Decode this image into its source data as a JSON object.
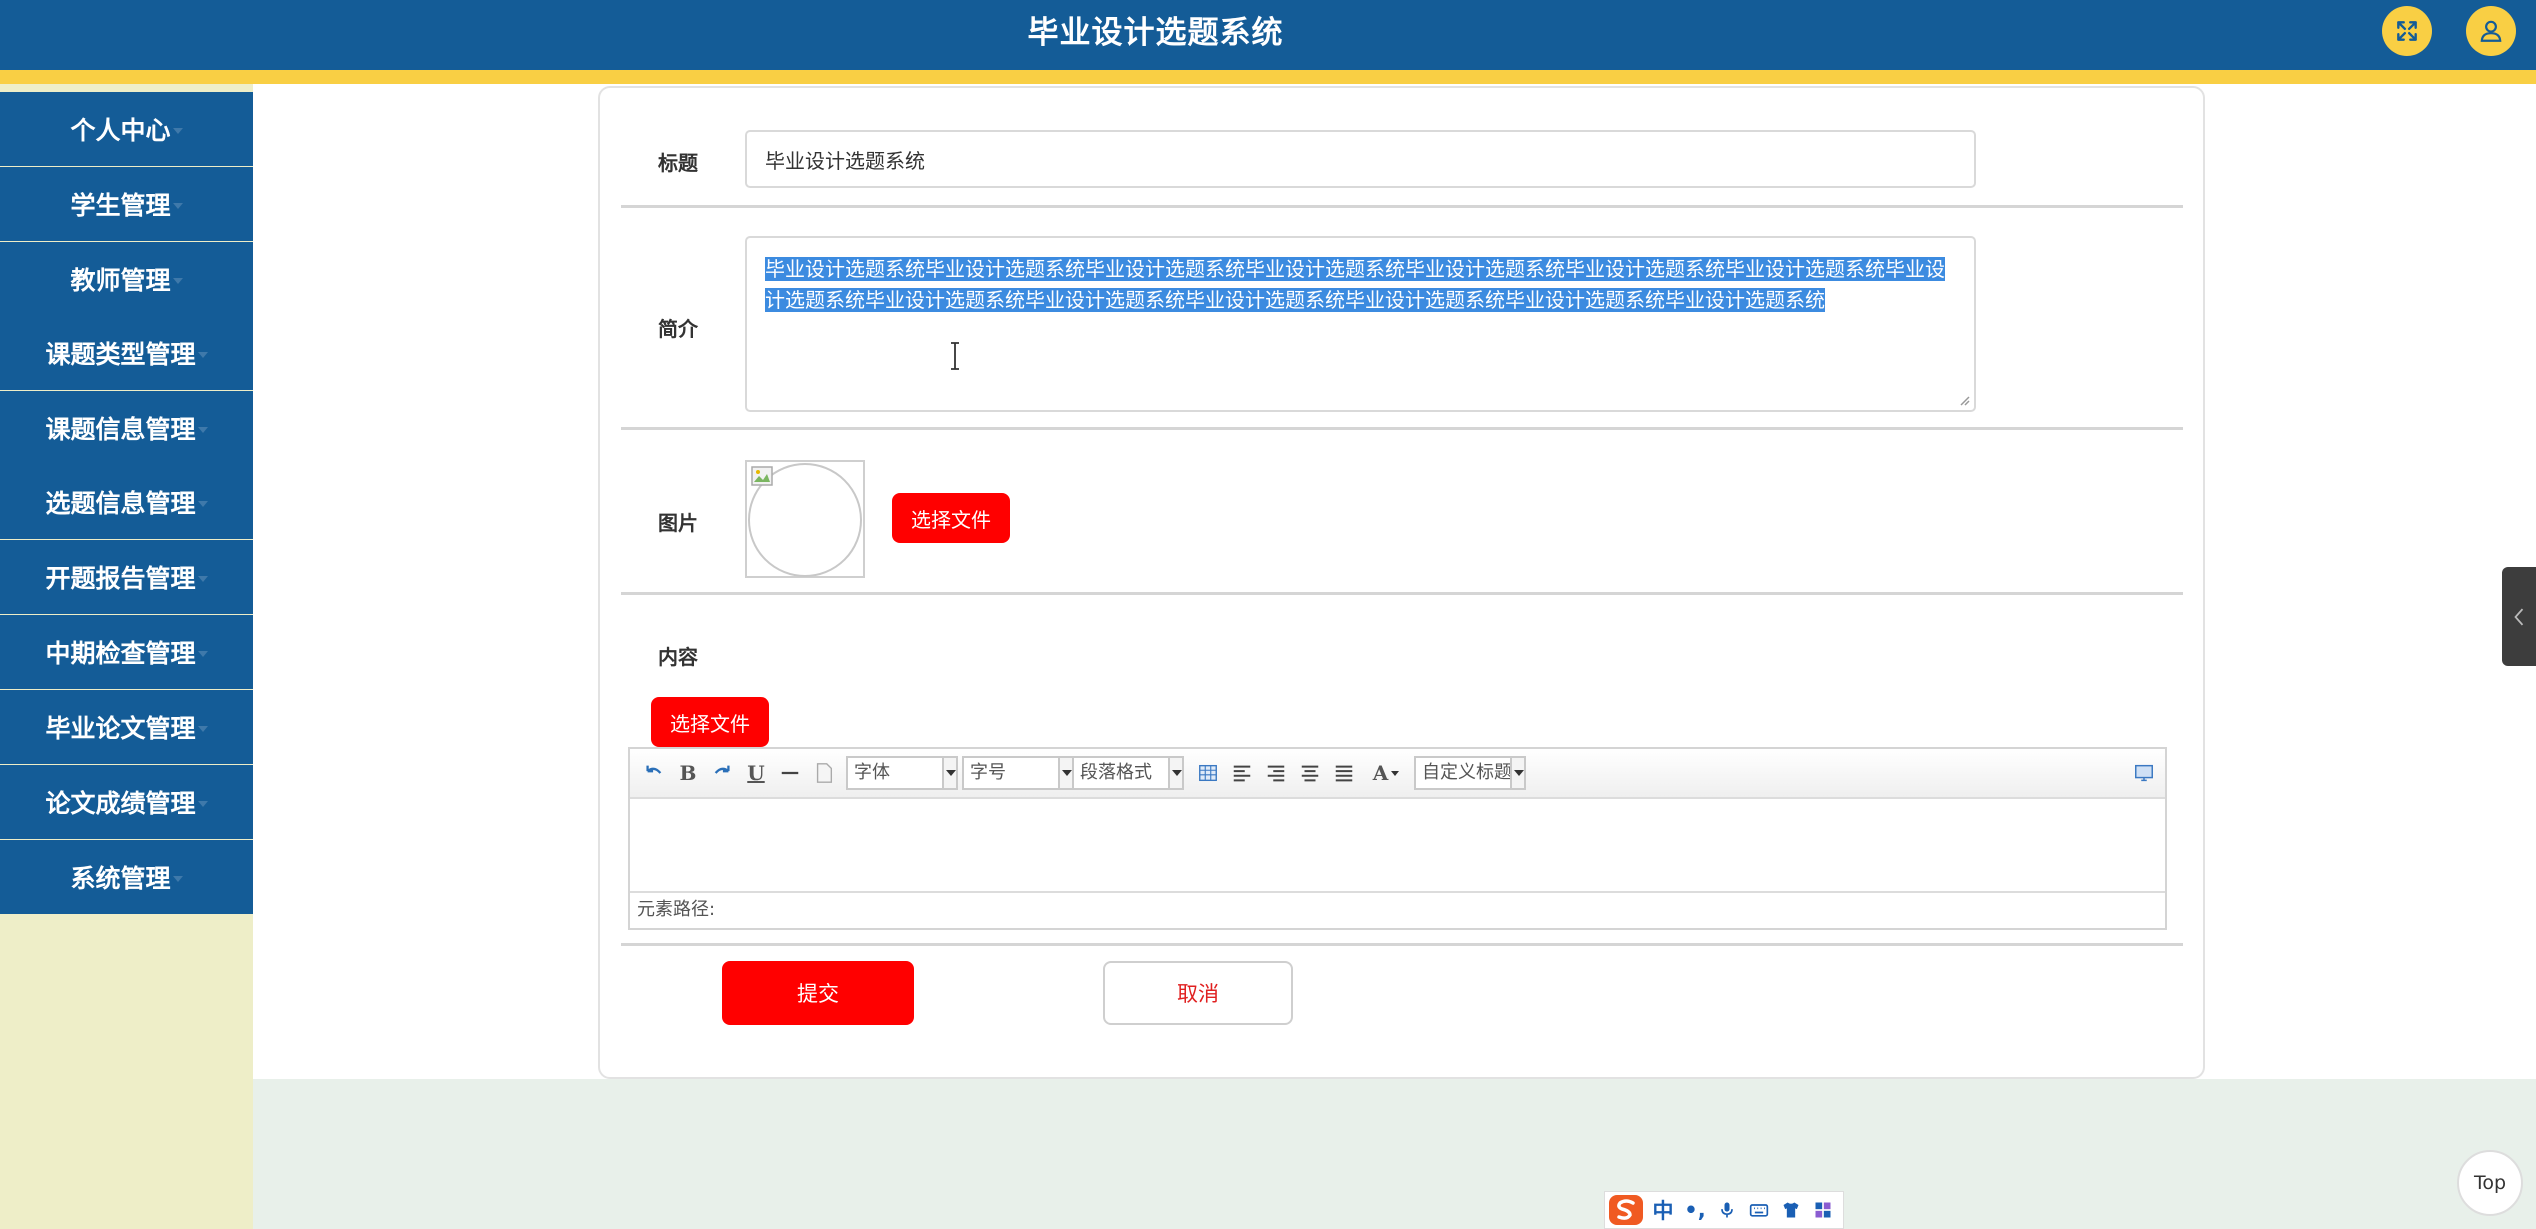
{
  "header": {
    "title": "毕业设计选题系统",
    "fullscreen_icon": "fullscreen-icon",
    "user_icon": "user-icon"
  },
  "sidebar": {
    "items": [
      {
        "label": "个人中心"
      },
      {
        "label": "学生管理"
      },
      {
        "label": "教师管理"
      },
      {
        "label": "课题类型管理"
      },
      {
        "label": "课题信息管理"
      },
      {
        "label": "选题信息管理"
      },
      {
        "label": "开题报告管理"
      },
      {
        "label": "中期检查管理"
      },
      {
        "label": "毕业论文管理"
      },
      {
        "label": "论文成绩管理"
      },
      {
        "label": "系统管理"
      }
    ]
  },
  "form": {
    "title_label": "标题",
    "title_value": "毕业设计选题系统",
    "intro_label": "简介",
    "intro_value": "毕业设计选题系统毕业设计选题系统毕业设计选题系统毕业设计选题系统毕业设计选题系统毕业设计选题系统毕业设计选题系统毕业设计选题系统毕业设计选题系统毕业设计选题系统毕业设计选题系统毕业设计选题系统毕业设计选题系统毕业设计选题系统",
    "image_label": "图片",
    "choose_file_label": "选择文件",
    "content_label": "内容",
    "content_choose_file_label": "选择文件",
    "submit_label": "提交",
    "cancel_label": "取消"
  },
  "editor": {
    "font_select": "字体",
    "size_select": "字号",
    "paragraph_select": "段落格式",
    "custom_title_select": "自定义标题",
    "bold_label": "B",
    "underline_label": "U",
    "font_color_label": "A",
    "status_label": "元素路径:"
  },
  "floating": {
    "top_label": "Top"
  },
  "ime": {
    "lang_label": "中",
    "punct_label": "•,"
  },
  "colors": {
    "header_bg": "#145c97",
    "header_stripe": "#f9cf44",
    "sidebar_bg": "#eeeec8",
    "accent_red": "#ff0000",
    "selection": "#3c8be0"
  }
}
